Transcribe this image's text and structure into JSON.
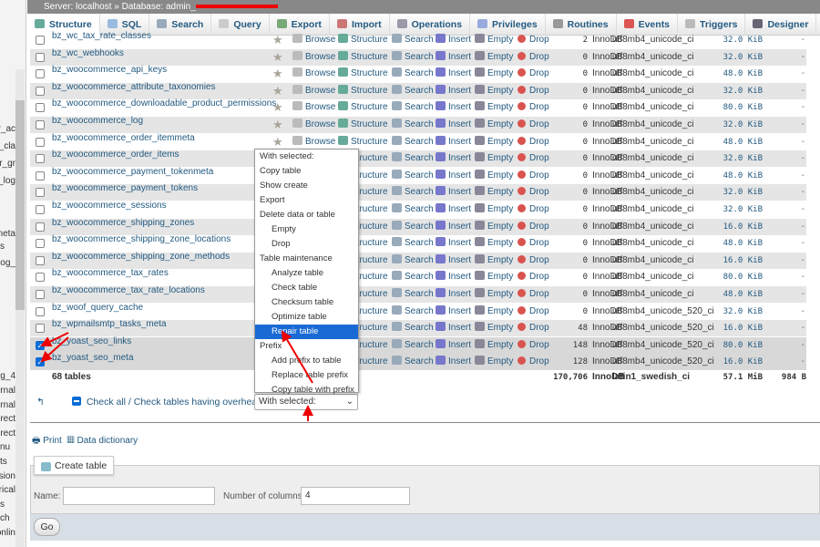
{
  "sidebar": {
    "fragments": [
      "r_ac",
      "r_cla",
      "r_gr",
      "r_log",
      "meta",
      "s",
      "_log",
      "4_log",
      "ernal",
      "ernal",
      "irect",
      "irect",
      "nu",
      "ts",
      "sion",
      "rical",
      "s",
      "ch",
      "onlin"
    ]
  },
  "breadcrumb": {
    "server": "Server: localhost",
    "separator": "»",
    "database": "Database: admin_"
  },
  "tabs": [
    {
      "label": "Structure",
      "icon": "structure-icon",
      "active": true
    },
    {
      "label": "SQL",
      "icon": "sql-icon"
    },
    {
      "label": "Search",
      "icon": "search-icon"
    },
    {
      "label": "Query",
      "icon": "query-icon"
    },
    {
      "label": "Export",
      "icon": "export-icon"
    },
    {
      "label": "Import",
      "icon": "import-icon"
    },
    {
      "label": "Operations",
      "icon": "wrench-icon"
    },
    {
      "label": "Privileges",
      "icon": "privileges-icon"
    },
    {
      "label": "Routines",
      "icon": "routines-icon"
    },
    {
      "label": "Events",
      "icon": "clock-icon"
    },
    {
      "label": "Triggers",
      "icon": "triggers-icon"
    },
    {
      "label": "Designer",
      "icon": "designer-icon"
    }
  ],
  "actions": {
    "browse": "Browse",
    "structure": "Structure",
    "search": "Search",
    "insert": "Insert",
    "empty": "Empty",
    "drop": "Drop"
  },
  "tables": [
    {
      "name": "bz_wc_tax_rate_classes",
      "rows": "2",
      "engine": "InnoDB",
      "collation": "utf8mb4_unicode_ci",
      "size": "32.0 KiB",
      "overhead": "-",
      "checked": false
    },
    {
      "name": "bz_wc_webhooks",
      "rows": "0",
      "engine": "InnoDB",
      "collation": "utf8mb4_unicode_ci",
      "size": "32.0 KiB",
      "overhead": "-",
      "checked": false
    },
    {
      "name": "bz_woocommerce_api_keys",
      "rows": "0",
      "engine": "InnoDB",
      "collation": "utf8mb4_unicode_ci",
      "size": "48.0 KiB",
      "overhead": "-",
      "checked": false
    },
    {
      "name": "bz_woocommerce_attribute_taxonomies",
      "rows": "0",
      "engine": "InnoDB",
      "collation": "utf8mb4_unicode_ci",
      "size": "32.0 KiB",
      "overhead": "-",
      "checked": false
    },
    {
      "name": "bz_woocommerce_downloadable_product_permissions",
      "rows": "0",
      "engine": "InnoDB",
      "collation": "utf8mb4_unicode_ci",
      "size": "80.0 KiB",
      "overhead": "-",
      "checked": false
    },
    {
      "name": "bz_woocommerce_log",
      "rows": "0",
      "engine": "InnoDB",
      "collation": "utf8mb4_unicode_ci",
      "size": "32.0 KiB",
      "overhead": "-",
      "checked": false
    },
    {
      "name": "bz_woocommerce_order_itemmeta",
      "rows": "0",
      "engine": "InnoDB",
      "collation": "utf8mb4_unicode_ci",
      "size": "48.0 KiB",
      "overhead": "-",
      "checked": false
    },
    {
      "name": "bz_woocommerce_order_items",
      "rows": "0",
      "engine": "InnoDB",
      "collation": "utf8mb4_unicode_ci",
      "size": "32.0 KiB",
      "overhead": "-",
      "checked": false
    },
    {
      "name": "bz_woocommerce_payment_tokenmeta",
      "rows": "0",
      "engine": "InnoDB",
      "collation": "utf8mb4_unicode_ci",
      "size": "48.0 KiB",
      "overhead": "-",
      "checked": false
    },
    {
      "name": "bz_woocommerce_payment_tokens",
      "rows": "0",
      "engine": "InnoDB",
      "collation": "utf8mb4_unicode_ci",
      "size": "32.0 KiB",
      "overhead": "-",
      "checked": false
    },
    {
      "name": "bz_woocommerce_sessions",
      "rows": "0",
      "engine": "InnoDB",
      "collation": "utf8mb4_unicode_ci",
      "size": "32.0 KiB",
      "overhead": "-",
      "checked": false
    },
    {
      "name": "bz_woocommerce_shipping_zones",
      "rows": "0",
      "engine": "InnoDB",
      "collation": "utf8mb4_unicode_ci",
      "size": "16.0 KiB",
      "overhead": "-",
      "checked": false
    },
    {
      "name": "bz_woocommerce_shipping_zone_locations",
      "rows": "0",
      "engine": "InnoDB",
      "collation": "utf8mb4_unicode_ci",
      "size": "48.0 KiB",
      "overhead": "-",
      "checked": false
    },
    {
      "name": "bz_woocommerce_shipping_zone_methods",
      "rows": "0",
      "engine": "InnoDB",
      "collation": "utf8mb4_unicode_ci",
      "size": "16.0 KiB",
      "overhead": "-",
      "checked": false
    },
    {
      "name": "bz_woocommerce_tax_rates",
      "rows": "0",
      "engine": "InnoDB",
      "collation": "utf8mb4_unicode_ci",
      "size": "80.0 KiB",
      "overhead": "-",
      "checked": false
    },
    {
      "name": "bz_woocommerce_tax_rate_locations",
      "rows": "0",
      "engine": "InnoDB",
      "collation": "utf8mb4_unicode_ci",
      "size": "48.0 KiB",
      "overhead": "-",
      "checked": false
    },
    {
      "name": "bz_woof_query_cache",
      "rows": "0",
      "engine": "InnoDB",
      "collation": "utf8mb4_unicode_520_ci",
      "size": "32.0 KiB",
      "overhead": "-",
      "checked": false
    },
    {
      "name": "bz_wpmailsmtp_tasks_meta",
      "rows": "48",
      "engine": "InnoDB",
      "collation": "utf8mb4_unicode_520_ci",
      "size": "16.0 KiB",
      "overhead": "-",
      "checked": false
    },
    {
      "name": "bz_yoast_seo_links",
      "rows": "148",
      "engine": "InnoDB",
      "collation": "utf8mb4_unicode_520_ci",
      "size": "80.0 KiB",
      "overhead": "-",
      "checked": true
    },
    {
      "name": "bz_yoast_seo_meta",
      "rows": "128",
      "engine": "InnoDB",
      "collation": "utf8mb4_unicode_520_ci",
      "size": "16.0 KiB",
      "overhead": "-",
      "checked": true
    }
  ],
  "summary": {
    "tables": "68 tables",
    "rows": "170,706",
    "engine": "InnoDB",
    "collation": "latin1_swedish_ci",
    "size": "57.1 MiB",
    "overhead": "984 B"
  },
  "bulk": {
    "check_all": "Check all / Check tables having overhead",
    "select_value": "With selected:"
  },
  "menu": [
    {
      "label": "With selected:",
      "kind": "item"
    },
    {
      "label": "Copy table",
      "kind": "item"
    },
    {
      "label": "Show create",
      "kind": "item"
    },
    {
      "label": "Export",
      "kind": "item"
    },
    {
      "label": "Delete data or table",
      "kind": "group"
    },
    {
      "label": "Empty",
      "kind": "sub"
    },
    {
      "label": "Drop",
      "kind": "sub"
    },
    {
      "label": "Table maintenance",
      "kind": "group"
    },
    {
      "label": "Analyze table",
      "kind": "sub"
    },
    {
      "label": "Check table",
      "kind": "sub"
    },
    {
      "label": "Checksum table",
      "kind": "sub"
    },
    {
      "label": "Optimize table",
      "kind": "sub"
    },
    {
      "label": "Repair table",
      "kind": "sub",
      "highlighted": true
    },
    {
      "label": "Prefix",
      "kind": "group"
    },
    {
      "label": "Add prefix to table",
      "kind": "sub"
    },
    {
      "label": "Replace table prefix",
      "kind": "sub"
    },
    {
      "label": "Copy table with prefix",
      "kind": "sub"
    }
  ],
  "links": {
    "print": "Print",
    "data_dictionary": "Data dictionary"
  },
  "create_table": {
    "title": "Create table",
    "name_label": "Name:",
    "name_value": "",
    "columns_label": "Number of columns:",
    "columns_value": "4",
    "go": "Go"
  },
  "colors": {
    "link": "#235a81",
    "highlight": "#1a6ad6",
    "annotation_arrow": "#e00000"
  }
}
